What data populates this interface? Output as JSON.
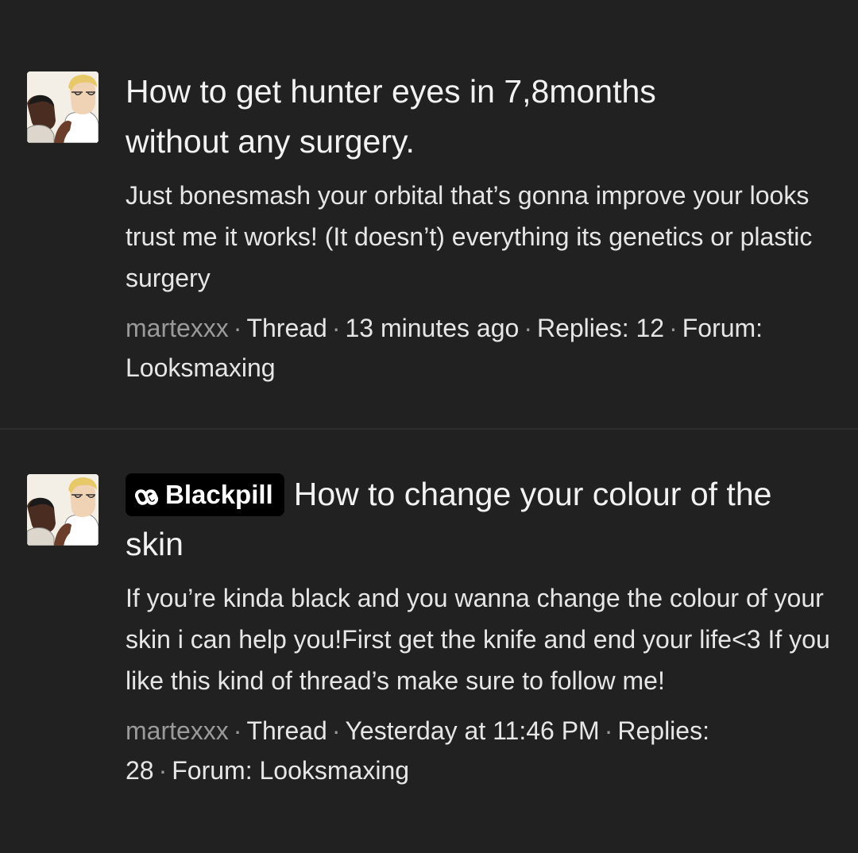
{
  "threads": [
    {
      "title": "How to get hunter eyes in 7,8months without any surgery.",
      "prefix": "",
      "snippet": "Just bonesmash your orbital that’s gonna improve your looks trust me it works! (It doesn’t) everything its genetics or plastic surgery",
      "author": "martexxx",
      "type": "Thread",
      "time": "13 minutes ago",
      "replies": "Replies: 12",
      "forum": "Forum: Looksmaxing",
      "avatar_icon": "avatar-illustration"
    },
    {
      "title": "How to change your colour of the skin",
      "prefix": "Blackpill",
      "prefix_icon": "pill-icon",
      "snippet": "If you’re kinda black and you wanna change the colour of your skin i can help you!First get the knife and end your life<3 If you like this kind of thread’s make sure to follow me!",
      "author": "martexxx",
      "type": "Thread",
      "time": "Yesterday at 11:46 PM",
      "replies": "Replies: 28",
      "forum": "Forum: Looksmaxing",
      "avatar_icon": "avatar-illustration"
    }
  ],
  "meta_separator": "·",
  "colors": {
    "background": "#212121",
    "text": "#e6e6e6",
    "muted": "#9a9a9a",
    "prefix_bg": "#000000"
  }
}
